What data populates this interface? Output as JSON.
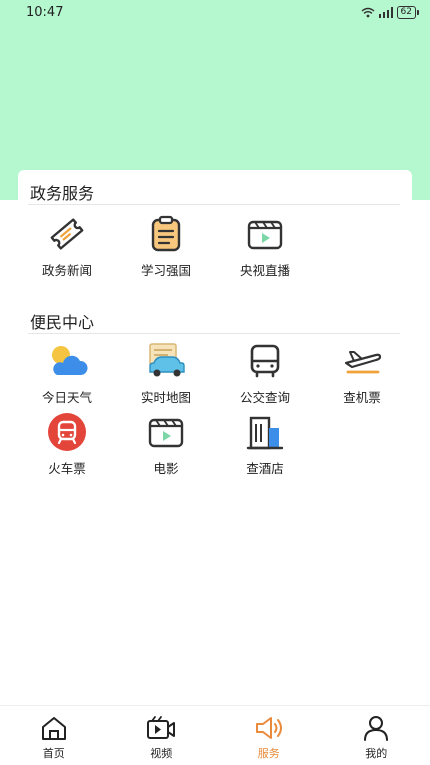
{
  "status": {
    "time": "10:47",
    "battery": "62"
  },
  "sections": [
    {
      "title": "政务服务",
      "items": [
        {
          "label": "政务新闻",
          "icon": "ticket-icon"
        },
        {
          "label": "学习强国",
          "icon": "clipboard-icon"
        },
        {
          "label": "央视直播",
          "icon": "video-player-icon"
        }
      ]
    },
    {
      "title": "便民中心",
      "items": [
        {
          "label": "今日天气",
          "icon": "weather-icon"
        },
        {
          "label": "实时地图",
          "icon": "map-car-icon"
        },
        {
          "label": "公交查询",
          "icon": "bus-icon"
        },
        {
          "label": "查机票",
          "icon": "airplane-icon"
        },
        {
          "label": "火车票",
          "icon": "train-icon"
        },
        {
          "label": "电影",
          "icon": "movie-icon"
        },
        {
          "label": "查酒店",
          "icon": "hotel-icon"
        }
      ]
    }
  ],
  "tabbar": {
    "items": [
      {
        "label": "首页",
        "icon": "home-icon"
      },
      {
        "label": "视频",
        "icon": "video-camera-icon"
      },
      {
        "label": "服务",
        "icon": "speaker-icon"
      },
      {
        "label": "我的",
        "icon": "user-icon"
      }
    ],
    "active_label": "服务",
    "active_color": "#e98b3a"
  },
  "colors": {
    "hero_background": "#b5f7cf"
  }
}
